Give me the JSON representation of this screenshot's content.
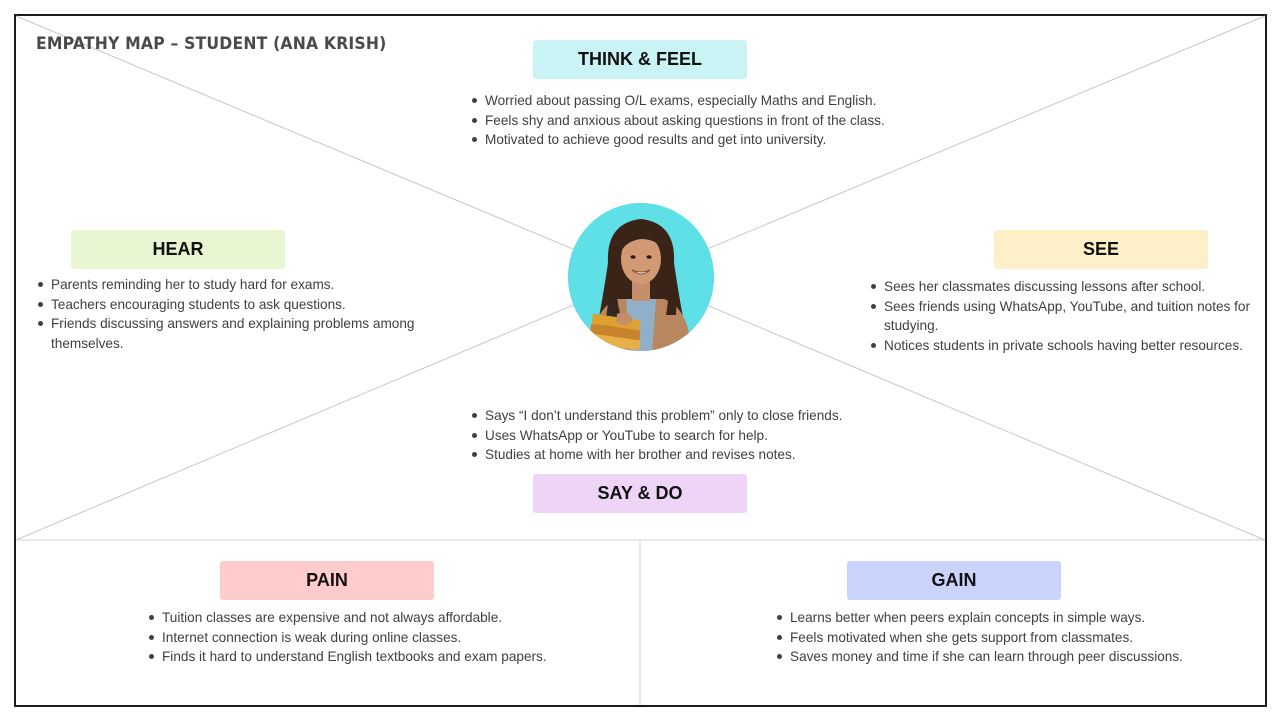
{
  "title": "EMPATHY MAP – STUDENT (ANA KRISH)",
  "colors": {
    "think_feel": "#c9f3f5",
    "hear": "#e9f6d2",
    "see": "#fdf0c8",
    "say_do": "#eed5f8",
    "pain": "#ffcccc",
    "gain": "#c9d3fb",
    "avatar_bg": "#5ee0e6",
    "frame": "#1a1a1a"
  },
  "avatar": {
    "icon": "student-portrait-icon"
  },
  "think_feel": {
    "label": "THINK & FEEL",
    "items": [
      "Worried about passing O/L exams, especially Maths and English.",
      "Feels shy and anxious about asking questions in front of the class.",
      "Motivated to achieve good results and get into university."
    ]
  },
  "hear": {
    "label": "HEAR",
    "items": [
      "Parents reminding her to study hard for exams.",
      "Teachers encouraging students to ask questions.",
      "Friends discussing answers and explaining problems among themselves."
    ]
  },
  "see": {
    "label": "SEE",
    "items": [
      "Sees her classmates discussing lessons after school.",
      "Sees friends using WhatsApp, YouTube, and tuition notes for studying.",
      "Notices students in private schools having better resources."
    ]
  },
  "say_do": {
    "label": "SAY & DO",
    "items": [
      "Says “I don’t understand this problem” only to close friends.",
      "Uses WhatsApp or YouTube to search for help.",
      "Studies at home with her brother and revises notes."
    ]
  },
  "pain": {
    "label": "PAIN",
    "items": [
      "Tuition classes are expensive and not always affordable.",
      "Internet connection is weak during online classes.",
      "Finds it hard to understand English textbooks and exam papers."
    ]
  },
  "gain": {
    "label": "GAIN",
    "items": [
      "Learns better when peers explain concepts in simple ways.",
      "Feels motivated when she gets support from classmates.",
      "Saves money and time if she can learn through peer discussions."
    ]
  }
}
